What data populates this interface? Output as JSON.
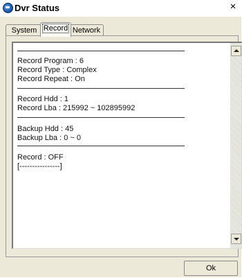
{
  "window": {
    "title": "Dvr Status",
    "close_glyph": "×",
    "icon": "app-globe-icon"
  },
  "tabs": [
    {
      "label": "System",
      "active": false
    },
    {
      "label": "Record",
      "active": true
    },
    {
      "label": "Network",
      "active": false
    }
  ],
  "record_text": {
    "program": "Record Program : 6",
    "type": "Record Type : Complex",
    "repeat": "Record Repeat : On",
    "hdd": "Record Hdd : 1",
    "lba": "Record Lba : 215992 ~ 102895992",
    "backup_hdd": "Backup Hdd : 45",
    "backup_lba": "Backup Lba : 0 ~ 0",
    "status": "Record : OFF",
    "progress": "[----------------]"
  },
  "buttons": {
    "ok": "Ok"
  },
  "colors": {
    "dialog_bg": "#ece9d8",
    "text": "#111111"
  }
}
